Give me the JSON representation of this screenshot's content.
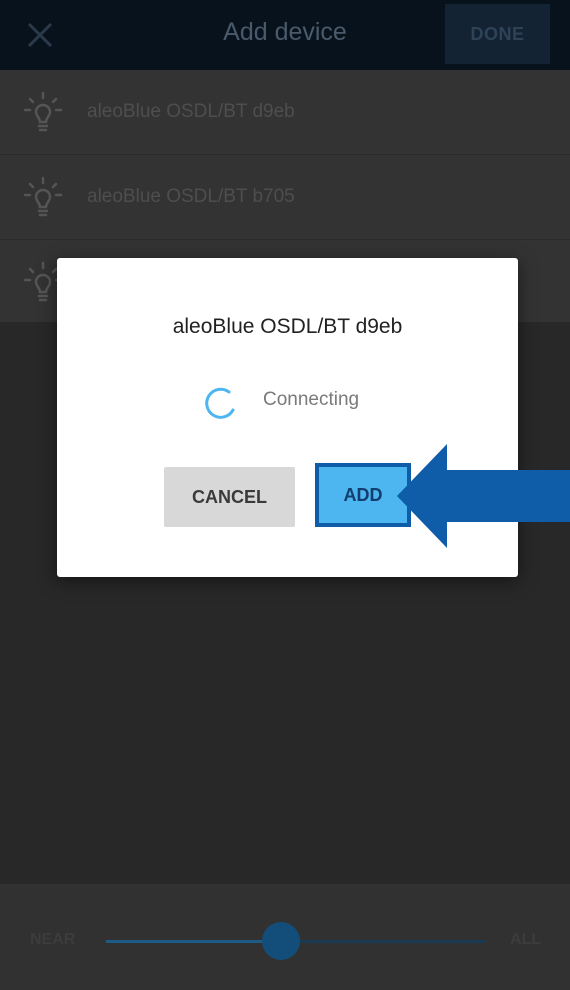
{
  "header": {
    "title": "Add device",
    "done_label": "DONE"
  },
  "devices": [
    {
      "name": "aleoBlue OSDL/BT d9eb",
      "icon": "bulb-icon"
    },
    {
      "name": "aleoBlue OSDL/BT b705",
      "icon": "bulb-icon"
    },
    {
      "name": "",
      "icon": "bulb-icon"
    }
  ],
  "dialog": {
    "title": "aleoBlue OSDL/BT d9eb",
    "status": "Connecting",
    "cancel_label": "CANCEL",
    "add_label": "ADD"
  },
  "range_slider": {
    "min_label": "NEAR",
    "max_label": "ALL",
    "value_fraction": 0.46
  },
  "colors": {
    "accent": "#4db5ef",
    "arrow": "#0f5ca8",
    "header_bg": "#07121d"
  }
}
